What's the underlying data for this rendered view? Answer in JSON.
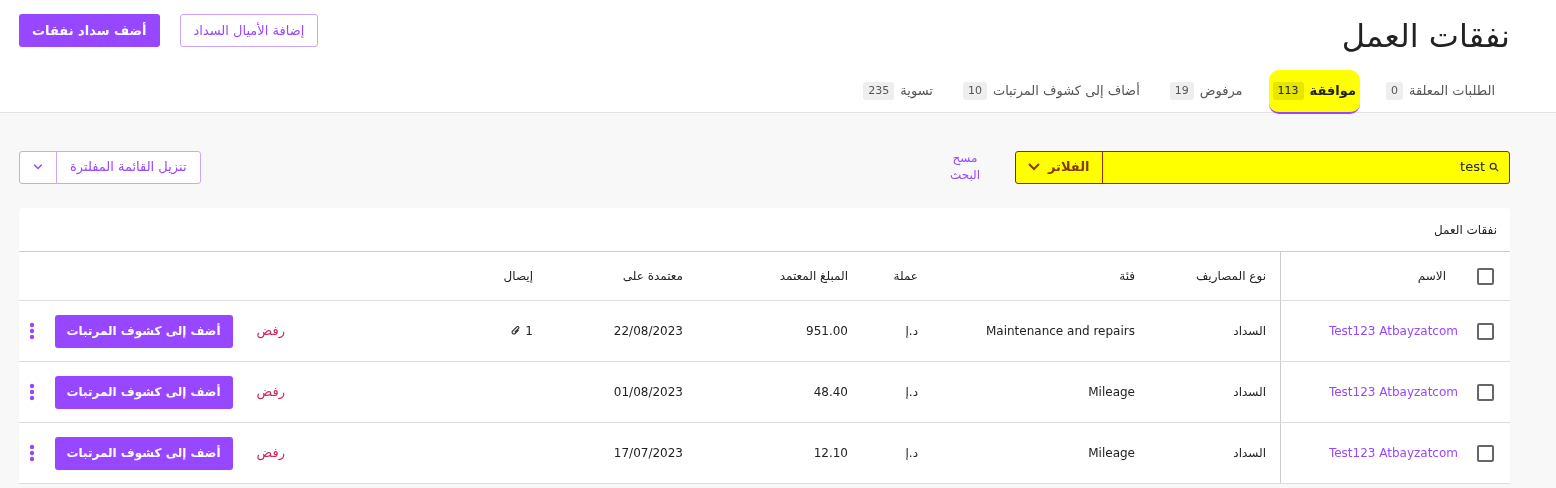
{
  "page": {
    "title": "نفقات العمل"
  },
  "header_buttons": [
    {
      "label": "إضافة الأميال السداد",
      "kind": "outline"
    },
    {
      "label": "أضف سداد نفقات",
      "kind": "primary"
    }
  ],
  "tabs": [
    {
      "label": "الطلبات المعلقة",
      "count": "0",
      "selected": false,
      "highlighted": false
    },
    {
      "label": "موافقة",
      "count": "113",
      "selected": true,
      "highlighted": true
    },
    {
      "label": "مرفوض",
      "count": "19",
      "selected": false,
      "highlighted": false
    },
    {
      "label": "أضاف إلى كشوف المرتبات",
      "count": "10",
      "selected": false,
      "highlighted": false
    },
    {
      "label": "تسوية",
      "count": "235",
      "selected": false,
      "highlighted": false
    }
  ],
  "search": {
    "value": "test",
    "highlighted": true,
    "filters_label": "الفلاتر"
  },
  "clear_search": "مسح البحث",
  "download_button": "تنزيل القائمة المفلترة",
  "table": {
    "title": "نفقات العمل",
    "select_all": {
      "checked": false
    },
    "columns": [
      "الاسم",
      "نوع المصاريف",
      "فئة",
      "عملة",
      "المبلغ المعتمد",
      "معتمدة على",
      "إيصال"
    ],
    "rows": [
      {
        "checked": false,
        "name": "Test123 Atbayzatcom",
        "type": "السداد",
        "category": "Maintenance and repairs",
        "currency": "د.إ",
        "amount": "951.00",
        "approved_on": "22/08/2023",
        "receipt": "1",
        "reject": "رفض",
        "action": "أضف إلى كشوف المرتبات"
      },
      {
        "checked": false,
        "name": "Test123 Atbayzatcom",
        "type": "السداد",
        "category": "Mileage",
        "currency": "د.إ",
        "amount": "48.40",
        "approved_on": "01/08/2023",
        "reject": "رفض",
        "action": "أضف إلى كشوف المرتبات"
      },
      {
        "checked": false,
        "name": "Test123 Atbayzatcom",
        "type": "السداد",
        "category": "Mileage",
        "currency": "د.إ",
        "amount": "12.10",
        "approved_on": "17/07/2023",
        "reject": "رفض",
        "action": "أضف إلى كشوف المرتبات"
      }
    ]
  }
}
